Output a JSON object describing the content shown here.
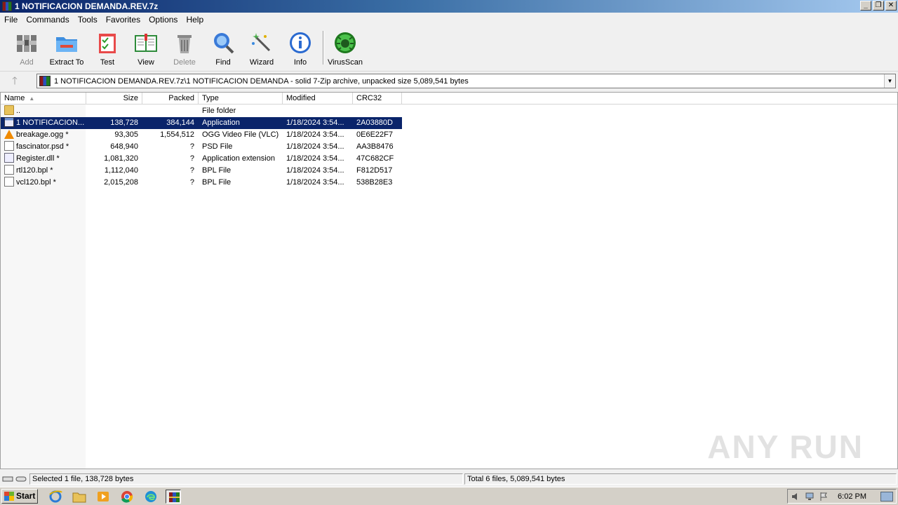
{
  "window": {
    "title": "1 NOTIFICACION DEMANDA.REV.7z",
    "controls": {
      "minimize": "_",
      "restore": "❐",
      "close": "✕"
    }
  },
  "menu": [
    "File",
    "Commands",
    "Tools",
    "Favorites",
    "Options",
    "Help"
  ],
  "toolbar": [
    {
      "label": "Add",
      "icon": "add-archive-icon",
      "enabled": false
    },
    {
      "label": "Extract To",
      "icon": "extract-folder-icon",
      "enabled": true
    },
    {
      "label": "Test",
      "icon": "test-checklist-icon",
      "enabled": true
    },
    {
      "label": "View",
      "icon": "view-book-icon",
      "enabled": true
    },
    {
      "label": "Delete",
      "icon": "trash-icon",
      "enabled": false
    },
    {
      "label": "Find",
      "icon": "magnifier-icon",
      "enabled": true
    },
    {
      "label": "Wizard",
      "icon": "wand-icon",
      "enabled": true
    },
    {
      "label": "Info",
      "icon": "info-icon",
      "enabled": true
    },
    {
      "label": "VirusScan",
      "icon": "virus-scan-icon",
      "enabled": true
    }
  ],
  "address": {
    "up_glyph": "🡑",
    "path": "1 NOTIFICACION DEMANDA.REV.7z\\1 NOTIFICACION DEMANDA - solid 7-Zip archive, unpacked size 5,089,541 bytes",
    "dropdown_glyph": "▼"
  },
  "columns": {
    "name": "Name",
    "size": "Size",
    "packed": "Packed",
    "type": "Type",
    "modified": "Modified",
    "crc": "CRC32"
  },
  "files": [
    {
      "name": "..",
      "size": "",
      "packed": "",
      "type": "File folder",
      "modified": "",
      "crc": "",
      "icon": "folder-icon",
      "selected": false
    },
    {
      "name": "1 NOTIFICACION...",
      "size": "138,728",
      "packed": "384,144",
      "type": "Application",
      "modified": "1/18/2024 3:54...",
      "crc": "2A03880D",
      "icon": "application-icon",
      "selected": true
    },
    {
      "name": "breakage.ogg *",
      "size": "93,305",
      "packed": "1,554,512",
      "type": "OGG Video File (VLC)",
      "modified": "1/18/2024 3:54...",
      "crc": "0E6E22F7",
      "icon": "vlc-icon",
      "selected": false
    },
    {
      "name": "fascinator.psd *",
      "size": "648,940",
      "packed": "?",
      "type": "PSD File",
      "modified": "1/18/2024 3:54...",
      "crc": "AA3B8476",
      "icon": "file-icon",
      "selected": false
    },
    {
      "name": "Register.dll *",
      "size": "1,081,320",
      "packed": "?",
      "type": "Application extension",
      "modified": "1/18/2024 3:54...",
      "crc": "47C682CF",
      "icon": "dll-icon",
      "selected": false
    },
    {
      "name": "rtl120.bpl *",
      "size": "1,112,040",
      "packed": "?",
      "type": "BPL File",
      "modified": "1/18/2024 3:54...",
      "crc": "F812D517",
      "icon": "file-icon",
      "selected": false
    },
    {
      "name": "vcl120.bpl *",
      "size": "2,015,208",
      "packed": "?",
      "type": "BPL File",
      "modified": "1/18/2024 3:54...",
      "crc": "538B28E3",
      "icon": "file-icon",
      "selected": false
    }
  ],
  "status": {
    "left": "Selected 1 file, 138,728 bytes",
    "right": "Total 6 files, 5,089,541 bytes"
  },
  "taskbar": {
    "start_label": "Start",
    "items": [
      "internet-explorer-icon",
      "file-explorer-icon",
      "media-player-icon",
      "chrome-icon",
      "edge-icon",
      "winrar-icon"
    ],
    "active_item": "winrar-icon",
    "clock": "6:02 PM"
  },
  "watermark": "ANY RUN",
  "colors": {
    "selection": "#0a246a",
    "title_start": "#0a246a",
    "title_end": "#a6caf0"
  }
}
